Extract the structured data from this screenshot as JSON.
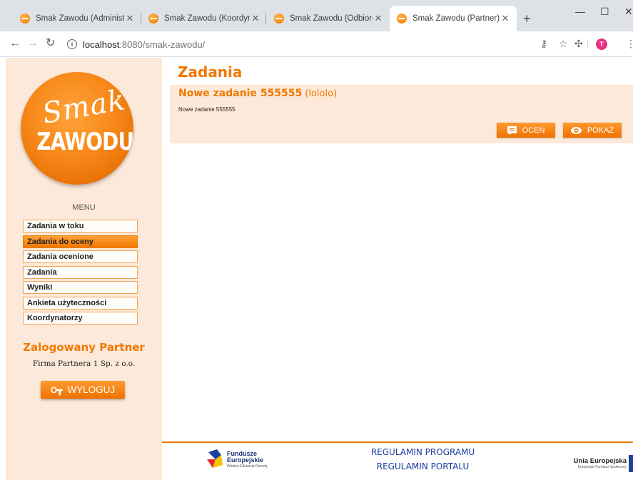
{
  "browser": {
    "tabs": [
      {
        "title": "Smak Zawodu (Administrator)",
        "active": false
      },
      {
        "title": "Smak Zawodu (Koordynator)",
        "active": false
      },
      {
        "title": "Smak Zawodu (Odbiorca)",
        "active": false
      },
      {
        "title": "Smak Zawodu (Partner)",
        "active": true
      }
    ],
    "close_glyph": "✕",
    "new_tab_glyph": "+",
    "window_controls": {
      "minimize": "—",
      "maximize": "☐",
      "close": "✕"
    },
    "url_host": "localhost",
    "url_rest": ":8080/smak-zawodu/",
    "info_glyph": "i",
    "avatar_letter": "T",
    "icons": [
      "back-arrow-icon",
      "forward-arrow-icon",
      "reload-icon",
      "info-icon",
      "key-icon",
      "star-icon",
      "extension-icon",
      "menu-dots-icon"
    ]
  },
  "sidebar": {
    "logo_top": "Smak",
    "logo_bottom": "ZAWODU",
    "menu_title": "MENU",
    "menu_items": [
      {
        "label": "Zadania w toku",
        "active": false
      },
      {
        "label": "Zadania do oceny",
        "active": true
      },
      {
        "label": "Zadania ocenione",
        "active": false
      },
      {
        "label": "Zadania",
        "active": false
      },
      {
        "label": "Wyniki",
        "active": false
      },
      {
        "label": "Ankieta użyteczności",
        "active": false
      },
      {
        "label": "Koordynatorzy",
        "active": false
      }
    ],
    "logged_title": "Zalogowany Partner",
    "company": "Firma Partnera 1 Sp. z o.o.",
    "logout_label": "WYLOGUJ"
  },
  "main": {
    "title": "Zadania",
    "task": {
      "name": "Nowe zadanie 555555",
      "subtitle": "(lololo)",
      "description": "Nowe zadanie 555555",
      "rate_label": "OCEŃ",
      "show_label": "POKAŻ"
    }
  },
  "footer": {
    "eu_funds_line1": "Fundusze",
    "eu_funds_line2": "Europejskie",
    "eu_funds_line3": "Wiedza Edukacja Rozwój",
    "regulamin_programu": "REGULAMIN PROGRAMU",
    "regulamin_portalu": "REGULAMIN PORTALU",
    "eu_union_line1": "Unia Europejska",
    "eu_union_line2": "Europejski Fundusz Społeczny"
  },
  "colors": {
    "accent": "#f07800",
    "sidebar_bg": "#fde9d9",
    "link": "#1a3aa0"
  }
}
